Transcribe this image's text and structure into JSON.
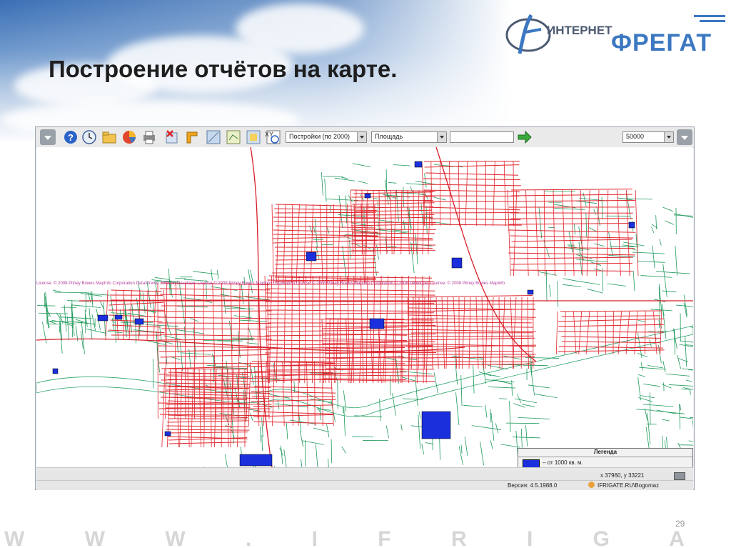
{
  "slide": {
    "title": "Построение отчётов на карте.",
    "page_number": "29",
    "footer_band": "W W W . I F R I G A T E . R U"
  },
  "logo": {
    "line1": "ИНТЕРНЕТ",
    "line2": "ФРЕГАТ",
    "color": "#3c78c2"
  },
  "app": {
    "toolbar": {
      "icons": [
        "back-icon",
        "help-icon",
        "clock-icon",
        "open-folder-icon",
        "pie-chart-icon",
        "print-icon",
        "delete-layer-icon",
        "corner-icon",
        "select-area-icon",
        "map-layer-icon",
        "tile-icon",
        "frame-icon",
        "coordinate-icon"
      ],
      "layer_select": "Постройки (по 2000)",
      "field_select": "Площадь",
      "filter_value": "",
      "scale_select": "50000"
    },
    "legend": {
      "title": "Легенда",
      "item_label": "– от 1000 кв. м.",
      "item_color": "#1b2fdc"
    },
    "coordinates": "x 37960, y 33221",
    "status": {
      "version": "Версия: 4.5.1988.0",
      "user": "IFRIGATE.RU\\Bogomaz"
    },
    "watermark": "License. © 2008 Pitney Bowes MapInfo Corporation   DataXtreme 2008 (c) Developer License © 2008 Pitney Bowes MapInfo Corporation   License © 2008 Pitney Bowes MapInfo Corporation   © 2008 Developer License. © 2008 Pitney Bowes Mapinfo"
  }
}
